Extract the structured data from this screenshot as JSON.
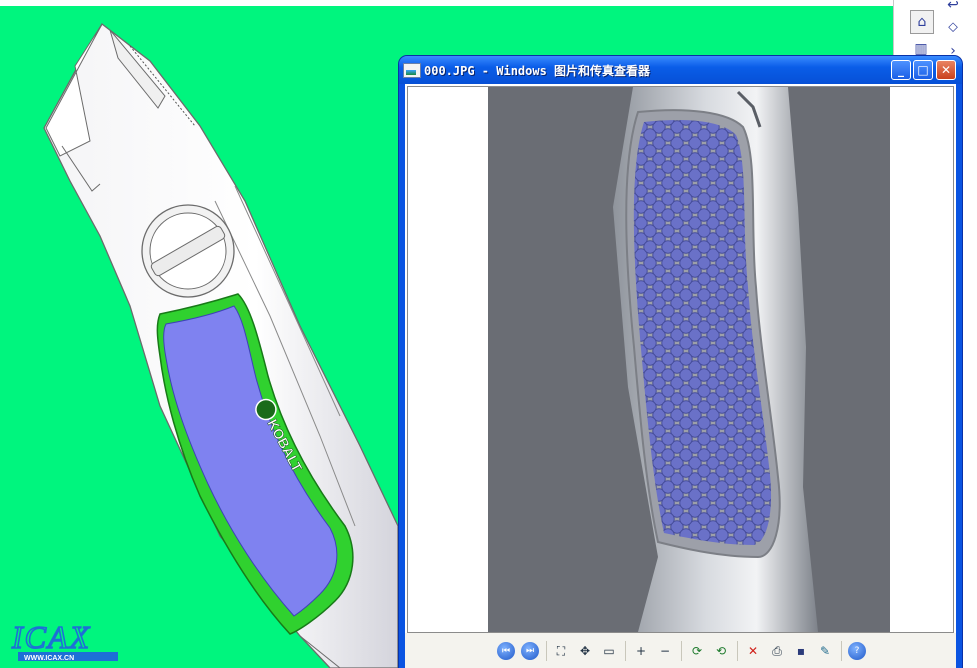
{
  "viewer": {
    "title": "000.JPG - Windows 图片和传真查看器",
    "caption_buttons": {
      "minimize": "_",
      "maximize": "□",
      "close": "✕"
    }
  },
  "cad_model": {
    "brand_label": "KOBALT"
  },
  "watermark": {
    "logo_text": "ICAX",
    "url_text": "WWW.ICAX.CN"
  },
  "right_panel": {
    "icons": [
      "home-icon",
      "sketch-icon",
      "chart-icon",
      "arrow-icon",
      "partial-icon"
    ]
  },
  "toolbar": {
    "buttons": [
      {
        "name": "previous-image-icon",
        "glyph": "⏮"
      },
      {
        "name": "next-image-icon",
        "glyph": "⏭"
      },
      {
        "name": "best-fit-icon",
        "glyph": "⛶"
      },
      {
        "name": "actual-size-icon",
        "glyph": "✥"
      },
      {
        "name": "slideshow-icon",
        "glyph": "▭"
      },
      {
        "name": "zoom-in-icon",
        "glyph": "+"
      },
      {
        "name": "zoom-out-icon",
        "glyph": "−"
      },
      {
        "name": "rotate-clockwise-icon",
        "glyph": "⟳"
      },
      {
        "name": "rotate-counterclockwise-icon",
        "glyph": "⟲"
      },
      {
        "name": "delete-icon",
        "glyph": "✕"
      },
      {
        "name": "print-icon",
        "glyph": "⎙"
      },
      {
        "name": "save-icon",
        "glyph": "▪"
      },
      {
        "name": "edit-icon",
        "glyph": "✎"
      },
      {
        "name": "help-icon",
        "glyph": "?"
      }
    ]
  },
  "colors": {
    "viewport_bg": "#00f57e",
    "titlebar": "#0a5de8",
    "grip_blue": "#7f82f0",
    "grip_outline": "#2ad12a",
    "photo_bg": "#6a6d74",
    "photo_grip": "#5c63b8"
  }
}
